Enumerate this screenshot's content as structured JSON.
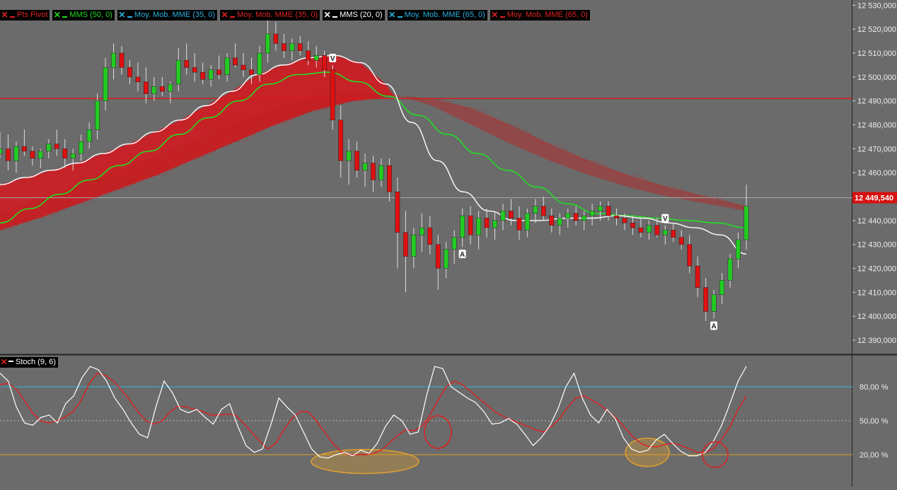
{
  "legend": [
    {
      "label": "Pts Pivot",
      "color": "#e02020"
    },
    {
      "label": "MMS (50, 0)",
      "color": "#22dd22"
    },
    {
      "label": "Moy. Mob. MME (35, 0)",
      "color": "#2bb0e0"
    },
    {
      "label": "Moy. Mob. MME (35, 0)",
      "color": "#e02020"
    },
    {
      "label": "MMS (20, 0)",
      "color": "#ffffff"
    },
    {
      "label": "Moy. Mob. MME (65, 0)",
      "color": "#2bb0e0"
    },
    {
      "label": "Moy. Mob. MME (65, 0)",
      "color": "#e02020"
    }
  ],
  "stoch_legend": {
    "label": "Stoch (9, 6)",
    "color": "#ffffff"
  },
  "current_price_label": "12 449,540",
  "price_axis": {
    "ticks": [
      "12 530,000",
      "12 520,000",
      "12 510,000",
      "12 500,000",
      "12 490,000",
      "12 480,000",
      "12 470,000",
      "12 460,000",
      "12 440,000",
      "12 430,000",
      "12 420,000",
      "12 410,000",
      "12 400,000",
      "12 390,000"
    ]
  },
  "stoch_axis": {
    "ticks": [
      "80,00 %",
      "50,00 %",
      "20,00 %"
    ]
  },
  "markers": [
    "V",
    "A",
    "V",
    "A"
  ],
  "colors": {
    "up": "#22cc22",
    "down": "#e01010",
    "resistance": "#d81818",
    "current_line": "#a8a8a8",
    "overbought": "#29b6d8",
    "oversold": "#e0a020",
    "stoch_k": "#ffffff",
    "stoch_d": "#e02020"
  },
  "chart_data": [
    {
      "type": "candlestick",
      "title": "",
      "ylim": [
        12385,
        12531
      ],
      "ytick_values": [
        12530,
        12520,
        12510,
        12500,
        12490,
        12480,
        12470,
        12460,
        12440,
        12430,
        12420,
        12410,
        12400,
        12390
      ],
      "horizontal_lines": {
        "resistance": 12491,
        "current_price": 12449.54
      },
      "candles": [
        [
          12468,
          12477,
          12466,
          12470
        ],
        [
          12470,
          12476,
          12461,
          12465
        ],
        [
          12465,
          12473,
          12460,
          12471
        ],
        [
          12471,
          12478,
          12467,
          12469
        ],
        [
          12469,
          12471,
          12463,
          12466
        ],
        [
          12466,
          12470,
          12462,
          12469
        ],
        [
          12469,
          12474,
          12466,
          12472
        ],
        [
          12472,
          12478,
          12467,
          12470
        ],
        [
          12470,
          12474,
          12462,
          12466
        ],
        [
          12466,
          12470,
          12461,
          12468
        ],
        [
          12468,
          12476,
          12465,
          12473
        ],
        [
          12473,
          12481,
          12470,
          12478
        ],
        [
          12478,
          12493,
          12474,
          12490
        ],
        [
          12490,
          12508,
          12486,
          12504
        ],
        [
          12504,
          12514,
          12499,
          12510
        ],
        [
          12510,
          12513,
          12501,
          12504
        ],
        [
          12504,
          12507,
          12497,
          12500
        ],
        [
          12500,
          12506,
          12494,
          12498
        ],
        [
          12498,
          12504,
          12489,
          12493
        ],
        [
          12493,
          12500,
          12490,
          12496
        ],
        [
          12496,
          12500,
          12492,
          12494
        ],
        [
          12494,
          12498,
          12489,
          12497
        ],
        [
          12497,
          12512,
          12494,
          12507
        ],
        [
          12507,
          12514,
          12501,
          12504
        ],
        [
          12504,
          12510,
          12498,
          12502
        ],
        [
          12502,
          12506,
          12497,
          12499
        ],
        [
          12499,
          12505,
          12496,
          12503
        ],
        [
          12503,
          12509,
          12499,
          12501
        ],
        [
          12501,
          12510,
          12498,
          12508
        ],
        [
          12508,
          12514,
          12504,
          12505
        ],
        [
          12505,
          12510,
          12500,
          12503
        ],
        [
          12503,
          12508,
          12497,
          12501
        ],
        [
          12501,
          12513,
          12498,
          12510
        ],
        [
          12510,
          12524,
          12506,
          12518
        ],
        [
          12518,
          12523,
          12511,
          12514
        ],
        [
          12514,
          12518,
          12508,
          12511
        ],
        [
          12511,
          12516,
          12507,
          12514
        ],
        [
          12514,
          12517,
          12509,
          12511
        ],
        [
          12511,
          12515,
          12505,
          12507
        ],
        [
          12507,
          12513,
          12504,
          12509
        ],
        [
          12509,
          12511,
          12500,
          12503
        ],
        [
          12503,
          12505,
          12478,
          12482
        ],
        [
          12482,
          12488,
          12458,
          12465
        ],
        [
          12465,
          12474,
          12455,
          12469
        ],
        [
          12469,
          12473,
          12458,
          12461
        ],
        [
          12461,
          12468,
          12454,
          12464
        ],
        [
          12464,
          12467,
          12452,
          12457
        ],
        [
          12457,
          12466,
          12454,
          12463
        ],
        [
          12463,
          12466,
          12448,
          12452
        ],
        [
          12452,
          12458,
          12420,
          12435
        ],
        [
          12435,
          12444,
          12410,
          12425
        ],
        [
          12425,
          12437,
          12420,
          12434
        ],
        [
          12434,
          12443,
          12427,
          12437
        ],
        [
          12437,
          12442,
          12426,
          12430
        ],
        [
          12430,
          12434,
          12411,
          12420
        ],
        [
          12420,
          12431,
          12416,
          12428
        ],
        [
          12428,
          12436,
          12422,
          12433
        ],
        [
          12433,
          12445,
          12429,
          12442
        ],
        [
          12442,
          12446,
          12430,
          12434
        ],
        [
          12434,
          12444,
          12428,
          12441
        ],
        [
          12441,
          12445,
          12433,
          12437
        ],
        [
          12437,
          12444,
          12432,
          12440
        ],
        [
          12440,
          12447,
          12436,
          12444
        ],
        [
          12444,
          12449,
          12438,
          12441
        ],
        [
          12441,
          12446,
          12432,
          12436
        ],
        [
          12436,
          12445,
          12433,
          12443
        ],
        [
          12443,
          12449,
          12439,
          12446
        ],
        [
          12446,
          12450,
          12440,
          12442
        ],
        [
          12442,
          12445,
          12435,
          12438
        ],
        [
          12438,
          12443,
          12434,
          12441
        ],
        [
          12441,
          12445,
          12437,
          12443
        ],
        [
          12443,
          12446,
          12438,
          12440
        ],
        [
          12440,
          12444,
          12436,
          12442
        ],
        [
          12442,
          12447,
          12438,
          12444
        ],
        [
          12444,
          12448,
          12440,
          12446
        ],
        [
          12446,
          12448,
          12440,
          12442
        ],
        [
          12442,
          12445,
          12438,
          12441
        ],
        [
          12441,
          12443,
          12436,
          12439
        ],
        [
          12439,
          12442,
          12434,
          12437
        ],
        [
          12437,
          12441,
          12433,
          12435
        ],
        [
          12435,
          12440,
          12432,
          12438
        ],
        [
          12438,
          12441,
          12433,
          12434
        ],
        [
          12434,
          12438,
          12430,
          12436
        ],
        [
          12436,
          12439,
          12431,
          12433
        ],
        [
          12433,
          12436,
          12428,
          12430
        ],
        [
          12430,
          12434,
          12418,
          12421
        ],
        [
          12421,
          12425,
          12408,
          12412
        ],
        [
          12412,
          12416,
          12398,
          12402
        ],
        [
          12402,
          12411,
          12399,
          12409
        ],
        [
          12409,
          12418,
          12405,
          12415
        ],
        [
          12415,
          12426,
          12412,
          12424
        ],
        [
          12424,
          12435,
          12420,
          12432
        ],
        [
          12432,
          12455,
          12428,
          12446
        ]
      ],
      "series": [
        {
          "name": "MMS (20, 0)",
          "values": [
            12455,
            12458,
            12461,
            12464,
            12468,
            12472,
            12477,
            12482,
            12488,
            12494,
            12501,
            12505,
            12508,
            12509,
            12506,
            12497,
            12481,
            12465,
            12452,
            12444,
            12440,
            12440,
            12441,
            12441,
            12442,
            12441,
            12439,
            12437,
            12434,
            12426
          ]
        },
        {
          "name": "MMS (50, 0)",
          "values": [
            12439,
            12445,
            12451,
            12457,
            12463,
            12469,
            12476,
            12483,
            12490,
            12497,
            12501,
            12502,
            12498,
            12492,
            12484,
            12476,
            12468,
            12461,
            12454,
            12447,
            12443,
            12442,
            12441,
            12440,
            12439,
            12437
          ]
        },
        {
          "name": "Moy. Mob. MME (35, 0)",
          "values": [
            12443,
            12449,
            12455,
            12461,
            12467,
            12474,
            12481,
            12487,
            12492,
            12494,
            12493,
            12488,
            12480,
            12472,
            12465,
            12459,
            12454,
            12450,
            12447,
            12444
          ]
        },
        {
          "name": "Moy. Mob. MME (65, 0)",
          "values": [
            12436,
            12441,
            12447,
            12453,
            12459,
            12466,
            12473,
            12480,
            12486,
            12490,
            12492,
            12491,
            12487,
            12480,
            12472,
            12465,
            12459,
            12454,
            12450,
            12446
          ]
        }
      ]
    },
    {
      "type": "line",
      "title": "Stoch (9, 6)",
      "ylim": [
        0,
        100
      ],
      "ytick_values": [
        80,
        50,
        20
      ],
      "series": [
        {
          "name": "%K",
          "values": [
            92,
            85,
            62,
            48,
            46,
            53,
            55,
            48,
            65,
            72,
            88,
            98,
            95,
            85,
            70,
            60,
            48,
            38,
            35,
            62,
            85,
            75,
            60,
            57,
            60,
            53,
            47,
            60,
            65,
            45,
            28,
            22,
            25,
            46,
            70,
            62,
            55,
            40,
            25,
            18,
            17,
            20,
            22,
            19,
            24,
            21,
            30,
            45,
            55,
            50,
            38,
            40,
            72,
            98,
            96,
            80,
            75,
            70,
            66,
            58,
            47,
            48,
            52,
            47,
            38,
            28,
            35,
            45,
            60,
            80,
            92,
            70,
            55,
            48,
            60,
            52,
            35,
            25,
            22,
            24,
            33,
            38,
            30,
            23,
            19,
            19,
            22,
            32,
            46,
            65,
            85,
            98
          ]
        },
        {
          "name": "%D",
          "values": [
            82,
            83,
            78,
            68,
            57,
            50,
            48,
            50,
            53,
            58,
            68,
            83,
            92,
            90,
            85,
            77,
            68,
            58,
            50,
            47,
            50,
            58,
            63,
            62,
            60,
            58,
            55,
            55,
            56,
            55,
            48,
            40,
            32,
            25,
            30,
            42,
            52,
            58,
            58,
            50,
            40,
            30,
            23,
            20,
            20,
            20,
            21,
            24,
            30,
            37,
            42,
            41,
            45,
            55,
            68,
            80,
            85,
            82,
            76,
            70,
            64,
            58,
            54,
            51,
            48,
            45,
            42,
            40,
            45,
            52,
            62,
            70,
            72,
            68,
            64,
            58,
            52,
            44,
            36,
            30,
            27,
            27,
            29,
            30,
            28,
            25,
            22,
            22,
            26,
            34,
            45,
            60,
            72
          ]
        }
      ]
    }
  ]
}
